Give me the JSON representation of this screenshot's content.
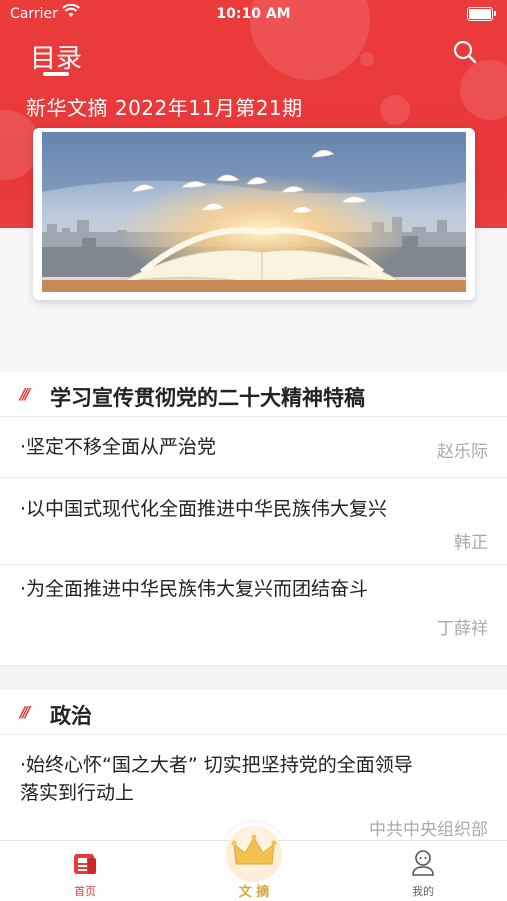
{
  "status_bar": {
    "carrier": "Carrier",
    "time": "10:10 AM"
  },
  "header": {
    "title": "目录",
    "issue": "新华文摘 2022年11月第21期"
  },
  "sections": [
    {
      "title": "学习宣传贯彻党的二十大精神特稿",
      "articles": [
        {
          "title": "·坚定不移全面从严治党",
          "author": "赵乐际"
        },
        {
          "title": "·以中国式现代化全面推进中华民族伟大复兴",
          "author": "韩正"
        },
        {
          "title": "·为全面推进中华民族伟大复兴而团结奋斗",
          "author": "丁薛祥"
        }
      ]
    },
    {
      "title": "政治",
      "articles": [
        {
          "title": "·始终心怀“国之大者” 切实把坚持党的全面领导落实到行动上",
          "author": "中共中央组织部"
        }
      ]
    }
  ],
  "tabbar": {
    "home": "首页",
    "digest": "文 摘",
    "mine": "我的"
  },
  "colors": {
    "accent": "#e8383a",
    "digest_tab": "#d4a642"
  }
}
